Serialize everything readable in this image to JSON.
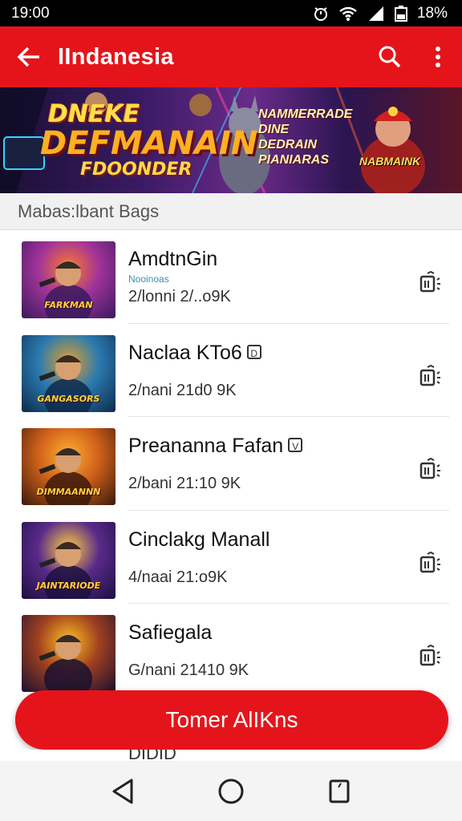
{
  "status_bar": {
    "time": "19:00",
    "battery": "18%"
  },
  "app_bar": {
    "title": "IIndanesia"
  },
  "banner": {
    "title_line1": "DNEKE",
    "title_line2": "DEFMANAIN",
    "title_line3": "FDOONDER",
    "tagline_line1": "NAMMERRADE",
    "tagline_line2": "DINE DEDRAIN",
    "tagline_line3": "PIANIARAS",
    "right_caption": "NABMAINK"
  },
  "section_header": "Mabas:lbant Bags",
  "items": [
    {
      "name": "AmdtnGin",
      "badge": "",
      "subtitle": "Nooinoas",
      "meta": "2/lonni 2/..o9K",
      "thumb_caption": "FARKMAN",
      "colors": [
        "#3a1a5e",
        "#a0339a",
        "#ff7a2a"
      ]
    },
    {
      "name": "Naclaa KTo6",
      "badge": "D",
      "subtitle": "",
      "meta": "2/nani 21d0 9K",
      "thumb_caption": "GANGASORS",
      "colors": [
        "#0e2a4a",
        "#2a7ab0",
        "#e0a030"
      ]
    },
    {
      "name": "Preananna Fafan",
      "badge": "V",
      "subtitle": "",
      "meta": "2/bani 21:10 9K",
      "thumb_caption": "DIMMAANNN",
      "colors": [
        "#3a1a0a",
        "#d0601a",
        "#ffb030"
      ]
    },
    {
      "name": "Cinclakg Manall",
      "badge": "",
      "subtitle": "",
      "meta": "4/naai 21:o9K",
      "thumb_caption": "JAINTARIODE",
      "colors": [
        "#1a1040",
        "#5a2a8a",
        "#ffd040"
      ]
    },
    {
      "name": "Safiegala",
      "badge": "",
      "subtitle": "",
      "meta": "G/nani 21410 9K",
      "thumb_caption": "",
      "colors": [
        "#1a1030",
        "#a04020",
        "#ffc020"
      ]
    }
  ],
  "fab_label": "Tomer AlIKns",
  "peek_text": "DIDID"
}
